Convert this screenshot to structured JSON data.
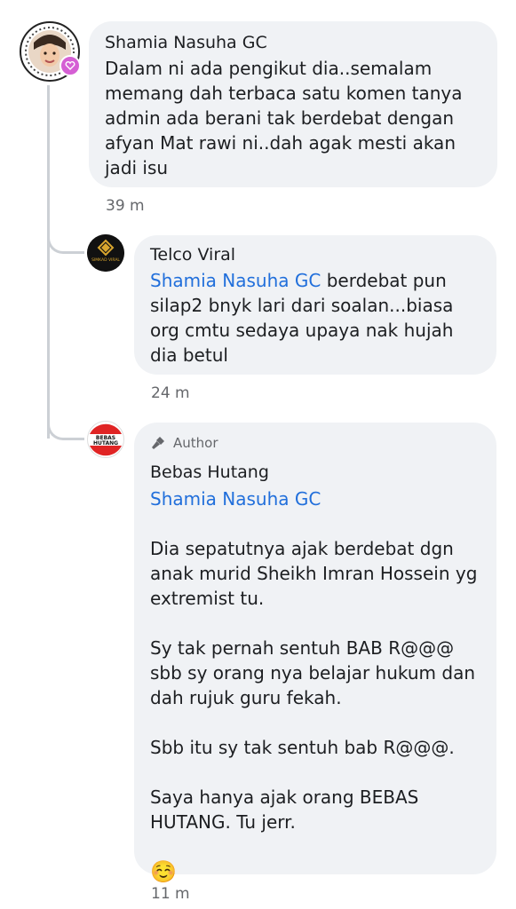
{
  "comments": [
    {
      "name": "Shamia Nasuha GC",
      "text": "Dalam ni ada pengikut dia..semalam memang dah terbaca satu komen tanya admin ada berani tak berdebat dengan afyan Mat rawi ni..dah agak mesti akan jadi isu",
      "time": "39 m"
    },
    {
      "name": "Telco Viral",
      "mention": "Shamia Nasuha GC",
      "text": " berdebat pun silap2 bnyk lari dari soalan...biasa org cmtu sedaya upaya nak hujah dia betul",
      "time": "24 m",
      "avatar_label": "SIMKAD VIRAL"
    },
    {
      "author_badge": "Author",
      "name": "Bebas Hutang",
      "mention": "Shamia Nasuha GC",
      "paragraphs": [
        "Dia sepatutnya ajak berdebat dgn anak murid Sheikh Imran Hossein yg extremist tu.",
        "Sy tak pernah sentuh BAB R@@@ sbb sy orang nya belajar hukum dan dah rujuk guru fekah.",
        "Sbb itu sy tak sentuh bab R@@@.",
        "Saya hanya ajak orang BEBAS HUTANG. Tu jerr."
      ],
      "emoji": "☺️",
      "time": "11 m",
      "avatar_label_1": "BEBAS",
      "avatar_label_2": "HUTANG"
    }
  ],
  "colors": {
    "bubble": "#f0f2f5",
    "mention": "#216fdb",
    "meta": "#65676b",
    "thread_line": "#ccd0d5"
  }
}
